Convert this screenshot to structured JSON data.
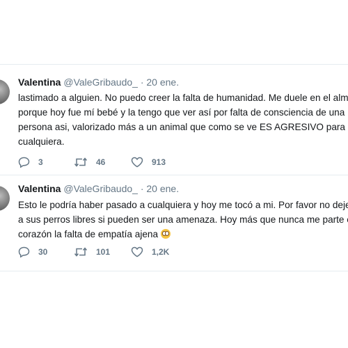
{
  "tweets": [
    {
      "name": "Valentina",
      "handle": "@ValeGribaudo_",
      "dot": "·",
      "date": "20 ene.",
      "lines": [
        "lastimado a alguien. No puedo creer la falta de humanidad. Me duele en el alma",
        "porque hoy fue mí bebé y la tengo que ver así por falta de consciencia de una",
        "persona asi, valorizado más a un animal que como se ve ES AGRESIVO para",
        "cualquiera."
      ],
      "replies": "3",
      "retweets": "46",
      "likes": "913"
    },
    {
      "name": "Valentina",
      "handle": "@ValeGribaudo_",
      "dot": "·",
      "date": "20 ene.",
      "lines": [
        "Esto le podría haber pasado a cualquiera y hoy me tocó a mi. Por favor no dejen",
        "a sus perros libres si pueden ser una amenaza. Hoy más que nunca me parte el",
        "corazón la falta de empatía ajena"
      ],
      "emoji": "emoji-icon",
      "replies": "30",
      "retweets": "101",
      "likes": "1,2K"
    }
  ],
  "icons": {
    "reply": "reply-icon",
    "retweet": "retweet-icon",
    "like": "heart-icon"
  },
  "colors": {
    "text": "#14171a",
    "secondary": "#657786",
    "divider": "#e6ecf0"
  }
}
